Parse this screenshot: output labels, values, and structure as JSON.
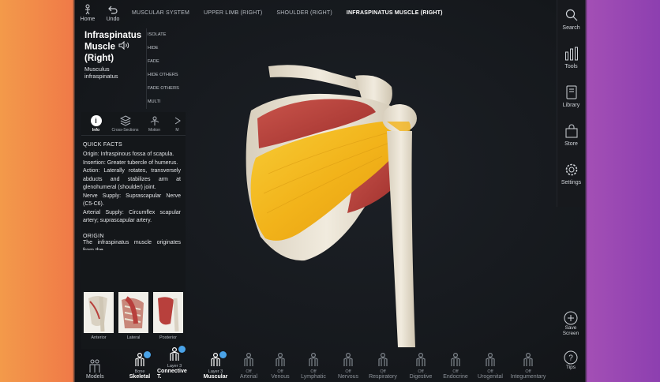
{
  "topbar": {
    "home_label": "Home",
    "undo_label": "Undo",
    "breadcrumbs": [
      "MUSCULAR SYSTEM",
      "UPPER LIMB (RIGHT)",
      "SHOULDER (RIGHT)",
      "INFRASPINATUS MUSCLE (RIGHT)"
    ]
  },
  "structure": {
    "title_line1": "Infraspinatus",
    "title_line2": "Muscle",
    "title_line3": "(Right)",
    "latin_line1": "Musculus",
    "latin_line2": "infraspinatus"
  },
  "actions": [
    "ISOLATE",
    "HIDE",
    "FADE",
    "HIDE OTHERS",
    "FADE OTHERS",
    "MULTI SELECTION"
  ],
  "info_tabs": [
    {
      "label": "Info",
      "icon": "info-icon"
    },
    {
      "label": "Cross-Sections",
      "icon": "layers-icon"
    },
    {
      "label": "Motion",
      "icon": "motion-icon"
    },
    {
      "label": "M",
      "icon": "more-icon"
    }
  ],
  "quick_facts": {
    "heading": "QUICK FACTS",
    "lines": [
      "Origin: Infraspinous fossa of scapula.",
      "Insertion: Greater tubercle of humerus.",
      "Action: Laterally rotates, transversely abducts and stabilizes arm at glenohumeral (shoulder) joint.",
      "Nerve Supply: Suprascapular Nerve (C5-C6).",
      "Arterial Supply: Circumflex scapular artery; suprascapular artery."
    ]
  },
  "origin": {
    "heading": "ORIGIN",
    "text": "The infraspinatus muscle originates from the"
  },
  "views": [
    "Anterior",
    "Lateral",
    "Posterior"
  ],
  "rail": [
    {
      "label": "Search",
      "icon": "search-icon"
    },
    {
      "label": "Tools",
      "icon": "tools-icon"
    },
    {
      "label": "Library",
      "icon": "library-icon"
    },
    {
      "label": "Store",
      "icon": "store-icon"
    },
    {
      "label": "Settings",
      "icon": "gear-icon"
    }
  ],
  "save_screen": {
    "line1": "Save",
    "line2": "Screen"
  },
  "tips_label": "Tips",
  "models_label": "Models",
  "systems": [
    {
      "sub": "Bone",
      "main": "Skeletal",
      "on": true
    },
    {
      "sub": "Layer 3",
      "main": "Connective T.",
      "on": true
    },
    {
      "sub": "Layer 3",
      "main": "Muscular",
      "on": true
    },
    {
      "sub": "Off",
      "main": "Arterial",
      "on": false
    },
    {
      "sub": "Off",
      "main": "Venous",
      "on": false
    },
    {
      "sub": "Off",
      "main": "Lymphatic",
      "on": false
    },
    {
      "sub": "Off",
      "main": "Nervous",
      "on": false
    },
    {
      "sub": "Off",
      "main": "Respiratory",
      "on": false
    },
    {
      "sub": "Off",
      "main": "Digestive",
      "on": false
    },
    {
      "sub": "Off",
      "main": "Endocrine",
      "on": false
    },
    {
      "sub": "Off",
      "main": "Urogenital",
      "on": false
    },
    {
      "sub": "Off",
      "main": "Integumentary",
      "on": false
    }
  ],
  "colors": {
    "selected_muscle": "#f2b31a",
    "muscle": "#b8403c",
    "bone": "#e9e2d2",
    "badge": "#4aa3e8"
  }
}
